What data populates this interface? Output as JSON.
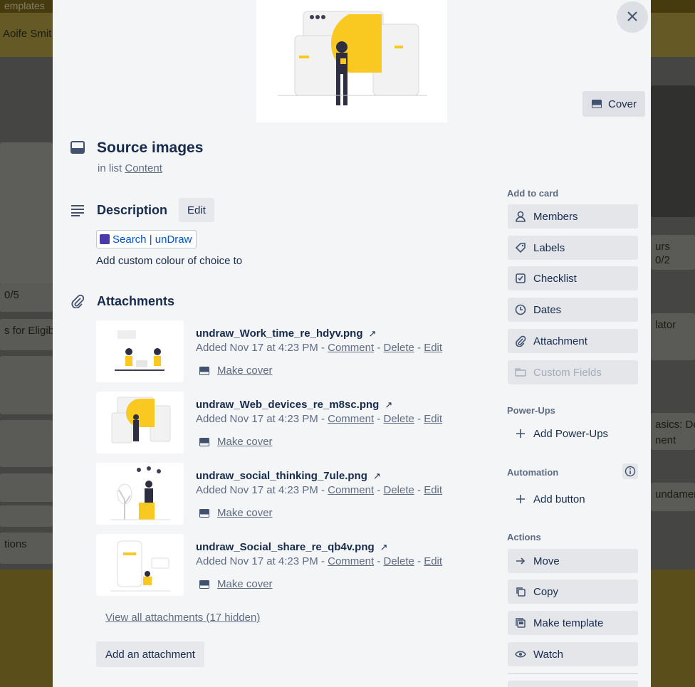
{
  "background": {
    "top_text": "emplates",
    "member_name": "Aoife Smit",
    "cards": [
      "0/5",
      "s for Eligib",
      "tions",
      "urs",
      "0/2",
      "lator",
      "asics: Des",
      "nent",
      "undamen"
    ]
  },
  "card": {
    "title": "Source images",
    "list_prefix": "in list",
    "list_name": "Content",
    "cover_label": "Cover"
  },
  "description": {
    "heading": "Description",
    "edit_label": "Edit",
    "link_text": "Search | unDraw",
    "text": "Add custom colour of choice to"
  },
  "attachments": {
    "heading": "Attachments",
    "items": [
      {
        "name": "undraw_Work_time_re_hdyv.png",
        "added": "Added Nov 17 at 4:23 PM",
        "comment": "Comment",
        "delete": "Delete",
        "edit": "Edit",
        "make_cover": "Make cover"
      },
      {
        "name": "undraw_Web_devices_re_m8sc.png",
        "added": "Added Nov 17 at 4:23 PM",
        "comment": "Comment",
        "delete": "Delete",
        "edit": "Edit",
        "make_cover": "Make cover"
      },
      {
        "name": "undraw_social_thinking_7ule.png",
        "added": "Added Nov 17 at 4:23 PM",
        "comment": "Comment",
        "delete": "Delete",
        "edit": "Edit",
        "make_cover": "Make cover"
      },
      {
        "name": "undraw_Social_share_re_qb4v.png",
        "added": "Added Nov 17 at 4:23 PM",
        "comment": "Comment",
        "delete": "Delete",
        "edit": "Edit",
        "make_cover": "Make cover"
      }
    ],
    "view_all": "View all attachments (17 hidden)",
    "add_button": "Add an attachment",
    "separator": "-",
    "external_glyph": "↗"
  },
  "sidebar": {
    "add_to_card": "Add to card",
    "members": "Members",
    "labels": "Labels",
    "checklist": "Checklist",
    "dates": "Dates",
    "attachment": "Attachment",
    "custom_fields": "Custom Fields",
    "powerups_heading": "Power-Ups",
    "add_powerups": "Add Power-Ups",
    "automation_heading": "Automation",
    "add_button": "Add button",
    "actions_heading": "Actions",
    "move": "Move",
    "copy": "Copy",
    "make_template": "Make template",
    "watch": "Watch"
  },
  "colors": {
    "accent_yellow": "#f9c921",
    "text_primary": "#172b4d",
    "text_subtle": "#5e6c84",
    "button_bg": "#e4e6ea",
    "link_blue": "#0052cc"
  },
  "icons": {
    "close": "close-icon",
    "cover": "card-cover-icon",
    "card": "card-icon",
    "description": "description-icon",
    "attachment": "paperclip-icon",
    "external": "external-link-icon"
  }
}
